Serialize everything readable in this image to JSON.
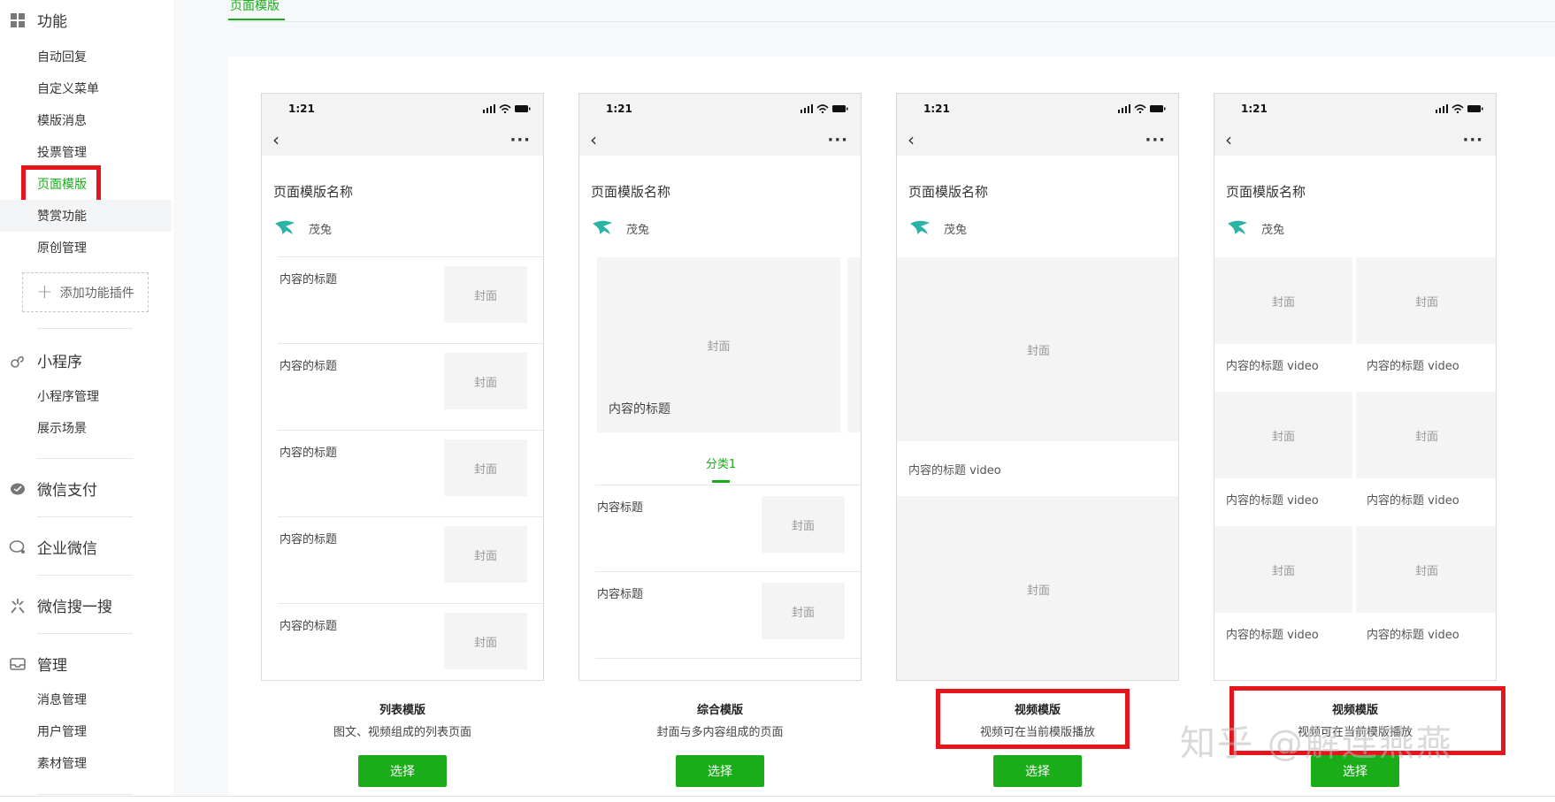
{
  "sidebar": {
    "sections": [
      {
        "title": "功能",
        "icon": "grid-icon",
        "items": [
          "自动回复",
          "自定义菜单",
          "模版消息",
          "投票管理",
          "页面模版",
          "赞赏功能",
          "原创管理"
        ],
        "add_plugin": "添加功能插件"
      },
      {
        "title": "小程序",
        "icon": "link-icon",
        "items": [
          "小程序管理",
          "展示场景"
        ]
      },
      {
        "title": "微信支付",
        "icon": "pay-icon"
      },
      {
        "title": "企业微信",
        "icon": "chat-icon"
      },
      {
        "title": "微信搜一搜",
        "icon": "sparkle-icon"
      },
      {
        "title": "管理",
        "icon": "inbox-icon",
        "items": [
          "消息管理",
          "用户管理",
          "素材管理"
        ]
      }
    ]
  },
  "tab": "页面模版",
  "phone_common": {
    "time": "1:21",
    "back": "‹",
    "more": "···",
    "page_title": "页面模版名称",
    "author": "茂兔",
    "cover": "封面"
  },
  "cards": [
    {
      "name": "列表模版",
      "desc": "图文、视频组成的列表页面",
      "button": "选择",
      "row_title": "内容的标题"
    },
    {
      "name": "综合模版",
      "desc": "封面与多内容组成的页面",
      "button": "选择",
      "hero_title": "内容的标题",
      "category": "分类1",
      "row_title": "内容标题"
    },
    {
      "name": "视频模版",
      "desc": "视频可在当前模版播放",
      "button": "选择",
      "video_title": "内容的标题 video"
    },
    {
      "name": "视频模版",
      "desc": "视频可在当前模版播放",
      "button": "选择",
      "video_title": "内容的标题 video"
    }
  ],
  "watermark": "知乎 @解连燕燕",
  "colors": {
    "accent": "#1aad19",
    "highlight_box": "#e6141b"
  }
}
